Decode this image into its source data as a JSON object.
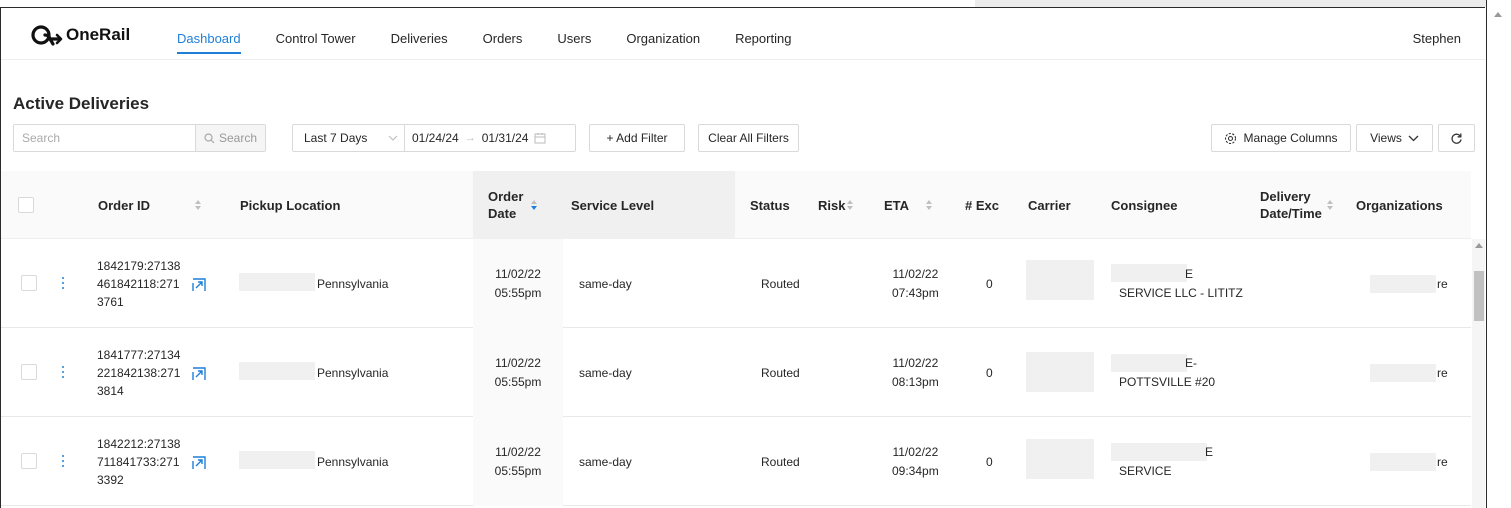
{
  "app": {
    "brand": "OneRail",
    "user": "Stephen",
    "accent": "#1f7fd8"
  },
  "nav": {
    "items": [
      {
        "label": "Dashboard",
        "active": true
      },
      {
        "label": "Control Tower"
      },
      {
        "label": "Deliveries"
      },
      {
        "label": "Orders"
      },
      {
        "label": "Users"
      },
      {
        "label": "Organization"
      },
      {
        "label": "Reporting"
      }
    ]
  },
  "page": {
    "title": "Active Deliveries"
  },
  "toolbar": {
    "search_placeholder": "Search",
    "search_button": "Search",
    "date_preset": "Last 7 Days",
    "date_from": "01/24/24",
    "date_to": "01/31/24",
    "add_filter": "+ Add Filter",
    "clear_filters": "Clear All Filters",
    "manage_columns": "Manage Columns",
    "views": "Views"
  },
  "table": {
    "columns": {
      "order_id": "Order ID",
      "pickup": "Pickup Location",
      "order_date_1": "Order",
      "order_date_2": "Date",
      "service": "Service Level",
      "status": "Status",
      "risk": "Risk",
      "eta": "ETA",
      "exc": "# Exc",
      "carrier": "Carrier",
      "consignee": "Consignee",
      "delivery_1": "Delivery",
      "delivery_2": "Date/Time",
      "orgs": "Organizations"
    },
    "rows": [
      {
        "ids": "1842179:27138461842118:2713761",
        "pickup": "Pennsylvania",
        "order_date": "11/02/22",
        "order_time": "05:55pm",
        "service": "same-day",
        "status": "Routed",
        "eta_date": "11/02/22",
        "eta_time": "07:43pm",
        "exc": "0",
        "consignee_1": "E",
        "consignee_2": "SERVICE LLC - LITITZ",
        "orgs": "re"
      },
      {
        "ids": "1841777:27134221842138:2713814",
        "pickup": "Pennsylvania",
        "order_date": "11/02/22",
        "order_time": "05:55pm",
        "service": "same-day",
        "status": "Routed",
        "eta_date": "11/02/22",
        "eta_time": "08:13pm",
        "exc": "0",
        "consignee_1": "E-",
        "consignee_2": "POTTSVILLE #20",
        "orgs": "re"
      },
      {
        "ids": "1842212:27138711841733:2713392",
        "pickup": "Pennsylvania",
        "order_date": "11/02/22",
        "order_time": "05:55pm",
        "service": "same-day",
        "status": "Routed",
        "eta_date": "11/02/22",
        "eta_time": "09:34pm",
        "exc": "0",
        "consignee_1": "E",
        "consignee_2": "SERVICE",
        "orgs": "re"
      }
    ]
  }
}
